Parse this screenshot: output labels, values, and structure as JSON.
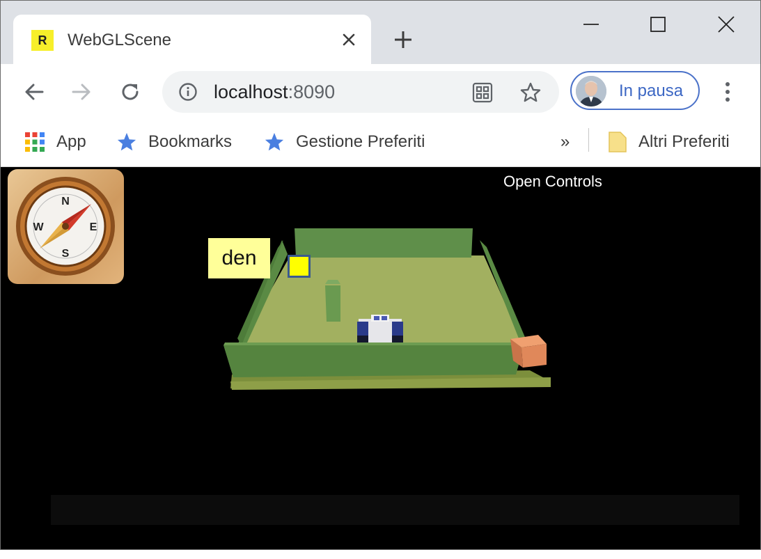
{
  "browser": {
    "tab": {
      "favicon_letter": "R",
      "title": "WebGLScene"
    },
    "address": {
      "host": "localhost",
      "port": ":8090"
    },
    "profile": {
      "label": "In pausa"
    },
    "bookmarks": {
      "apps_label": "App",
      "items": [
        "Bookmarks",
        "Gestione Preferiti"
      ],
      "overflow_glyph": "»",
      "other_label": "Altri Preferiti"
    },
    "colors": {
      "tabstrip": "#dee1e6",
      "profile_accent": "#4b72c9",
      "star_blue": "#4a7fe0"
    }
  },
  "page": {
    "open_controls_label": "Open Controls",
    "den_label": "den",
    "compass_letters": {
      "n": "N",
      "s": "S",
      "e": "E",
      "w": "W"
    },
    "colors": {
      "background": "#000000",
      "floor": "#a2b060",
      "wall": "#5b8b45",
      "block": "#e0885a",
      "marker": "#ffff00",
      "label_bg": "#ffff99"
    }
  }
}
